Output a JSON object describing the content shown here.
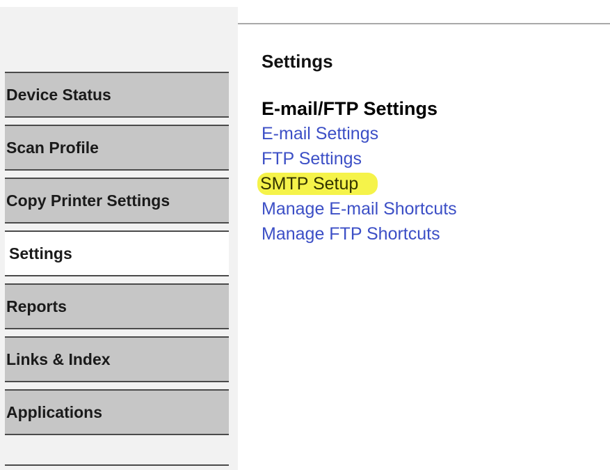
{
  "sidebar": {
    "items": [
      {
        "label": "Device Status"
      },
      {
        "label": "Scan Profile"
      },
      {
        "label": "Copy Printer Settings"
      },
      {
        "label": "Settings"
      },
      {
        "label": "Reports"
      },
      {
        "label": "Links & Index"
      },
      {
        "label": "Applications"
      }
    ],
    "active_item": "Settings"
  },
  "main": {
    "title": "Settings",
    "section_title": "E-mail/FTP Settings",
    "links": [
      {
        "label": "E-mail Settings"
      },
      {
        "label": "FTP Settings"
      },
      {
        "label": "SMTP Setup",
        "highlighted": true
      },
      {
        "label": "Manage E-mail Shortcuts"
      },
      {
        "label": "Manage FTP Shortcuts"
      }
    ]
  },
  "colors": {
    "nav_background": "#c6c6c6",
    "nav_active_background": "#ffffff",
    "link": "#3c4fc6",
    "highlight": "#f5f34a"
  }
}
